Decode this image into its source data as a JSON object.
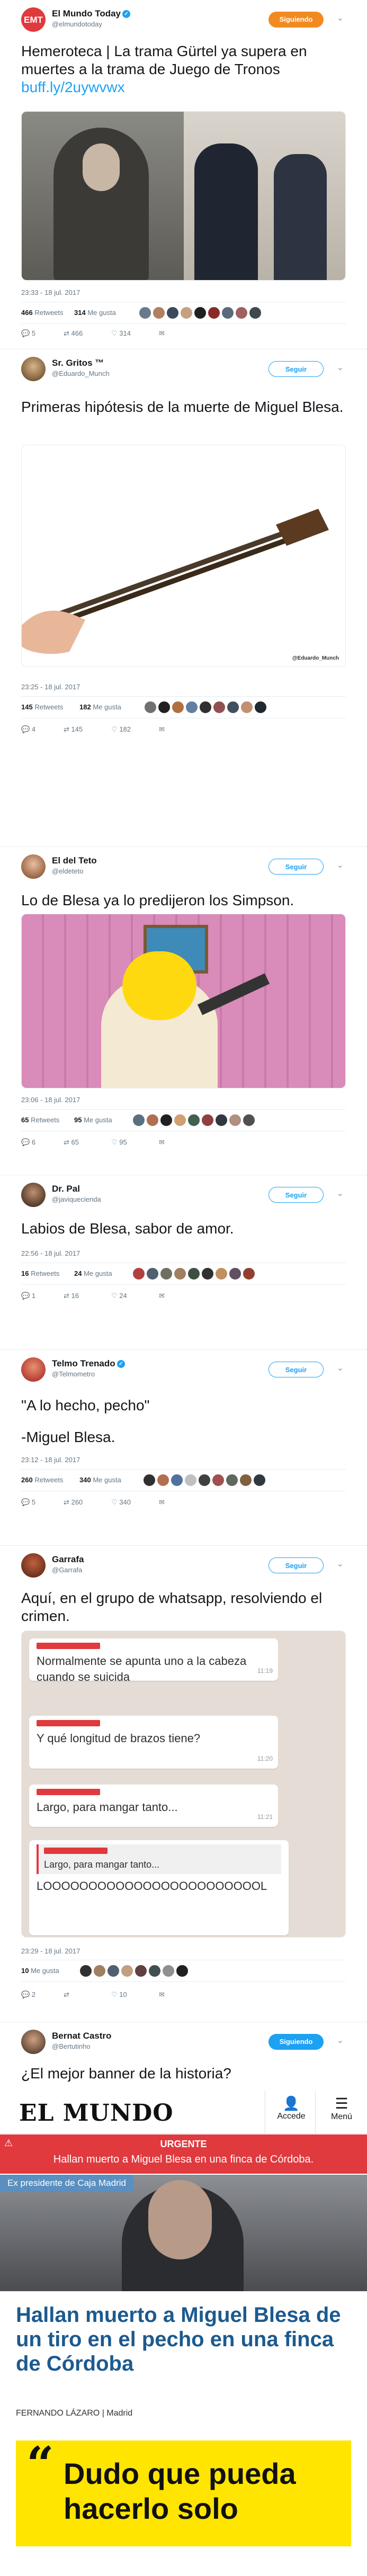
{
  "tweets": [
    {
      "user": "El Mundo Today",
      "handle": "@elmundotoday",
      "verified": true,
      "follow": "Siguiendo",
      "text": "Hemeroteca | La trama Gürtel ya supera en muertes a la trama de Juego de Tronos",
      "link": "buff.ly/2uywvwx",
      "time": "23:33 - 18 jul. 2017",
      "retweets": "466",
      "retweets_label": "Retweets",
      "likes": "314",
      "likes_label": "Me gusta",
      "reply": "5",
      "rt": "466",
      "fav": "314"
    },
    {
      "user": "Sr. Gritos ™",
      "handle": "@Eduardo_Munch",
      "verified": false,
      "follow": "Seguir",
      "text": "Primeras hipótesis de la muerte de Miguel Blesa.",
      "watermark": "@Eduardo_Munch",
      "time": "23:25 - 18 jul. 2017",
      "retweets": "145",
      "retweets_label": "Retweets",
      "likes": "182",
      "likes_label": "Me gusta",
      "reply": "4",
      "rt": "145",
      "fav": "182"
    },
    {
      "user": "El del Teto",
      "handle": "@eldeteto",
      "verified": false,
      "follow": "Seguir",
      "text": "Lo de Blesa ya lo predijeron los Simpson.",
      "time": "23:06 - 18 jul. 2017",
      "retweets": "65",
      "retweets_label": "Retweets",
      "likes": "95",
      "likes_label": "Me gusta",
      "reply": "6",
      "rt": "65",
      "fav": "95"
    },
    {
      "user": "Dr. Pal",
      "handle": "@javiquecienda",
      "verified": false,
      "follow": "Seguir",
      "text": "Labios de Blesa, sabor de amor.",
      "time": "22:56 - 18 jul. 2017",
      "retweets": "16",
      "retweets_label": "Retweets",
      "likes": "24",
      "likes_label": "Me gusta",
      "reply": "1",
      "rt": "16",
      "fav": "24"
    },
    {
      "user": "Telmo Trenado",
      "handle": "@Telmometro",
      "verified": true,
      "follow": "Seguir",
      "text": "\"A lo hecho, pecho\"",
      "text2": "-Miguel Blesa.",
      "time": "23:12 - 18 jul. 2017",
      "retweets": "260",
      "retweets_label": "Retweets",
      "likes": "340",
      "likes_label": "Me gusta",
      "reply": "5",
      "rt": "260",
      "fav": "340"
    },
    {
      "user": "Garrafa",
      "handle": "@Garrafa",
      "verified": false,
      "follow": "Seguir",
      "text": "Aquí, en el grupo de whatsapp, resolviendo el crimen.",
      "time": "23:29 - 18 jul. 2017",
      "likes": "10",
      "likes_label": "Me gusta",
      "reply": "2",
      "rt": "",
      "fav": "10"
    },
    {
      "user": "Bernat Castro",
      "handle": "@Bertutinho",
      "verified": false,
      "follow": "Siguiendo",
      "text": "¿El mejor banner de la historia?"
    }
  ],
  "whatsapp": [
    {
      "text": "Normalmente se apunta uno a la cabeza cuando se suicida",
      "time": "11:19"
    },
    {
      "text": "Y qué longitud de brazos tiene?",
      "time": "11:20"
    },
    {
      "text": "Largo, para mangar tanto...",
      "time": "11:21"
    },
    {
      "quote": "Largo, para mangar tanto...",
      "text": "LOOOOOOOOOOOOOOOOOOOOOOOOL",
      "time": ""
    }
  ],
  "elmundo": {
    "logo": "EL MUNDO",
    "accede": "Accede",
    "menu": "Menú",
    "urgente_label": "URGENTE",
    "urgente_text": "Hallan muerto a Miguel Blesa en una finca de Córdoba.",
    "photo_caption": "Ex presidente de Caja Madrid",
    "headline": "Hallan muerto a Miguel Blesa de un tiro en el pecho en una finca de Córdoba",
    "byline": "FERNANDO LÁZARO | Madrid",
    "quote": "Dudo que pueda hacerlo solo"
  },
  "colors": {
    "twitter_blue": "#1da1f2",
    "elmundo_red": "#e0393e",
    "quote_yellow": "#ffe500",
    "headline_blue": "#1c5a8f"
  }
}
